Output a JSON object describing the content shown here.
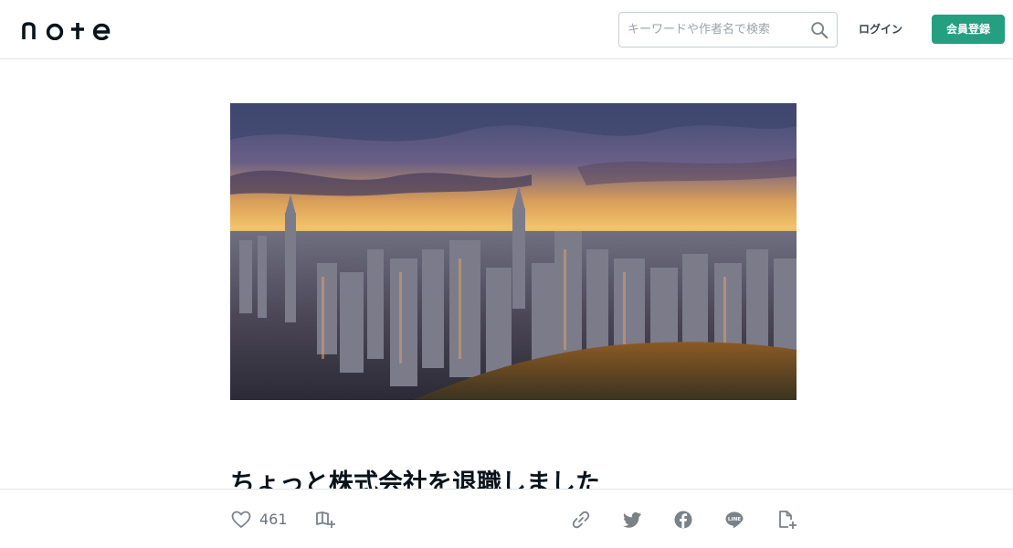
{
  "header": {
    "logo_text": "note",
    "search_placeholder": "キーワードや作者名で検索",
    "login_label": "ログイン",
    "signup_label": "会員登録",
    "signup_color": "#249f80"
  },
  "article": {
    "hero_image": "city-skyline-sunset",
    "title": "ちょっと株式会社を退職しました"
  },
  "action_bar": {
    "like_count": "461",
    "icons": [
      "heart-icon",
      "add-to-magazine-icon",
      "link-icon",
      "twitter-icon",
      "facebook-icon",
      "line-icon",
      "add-note-icon"
    ]
  }
}
